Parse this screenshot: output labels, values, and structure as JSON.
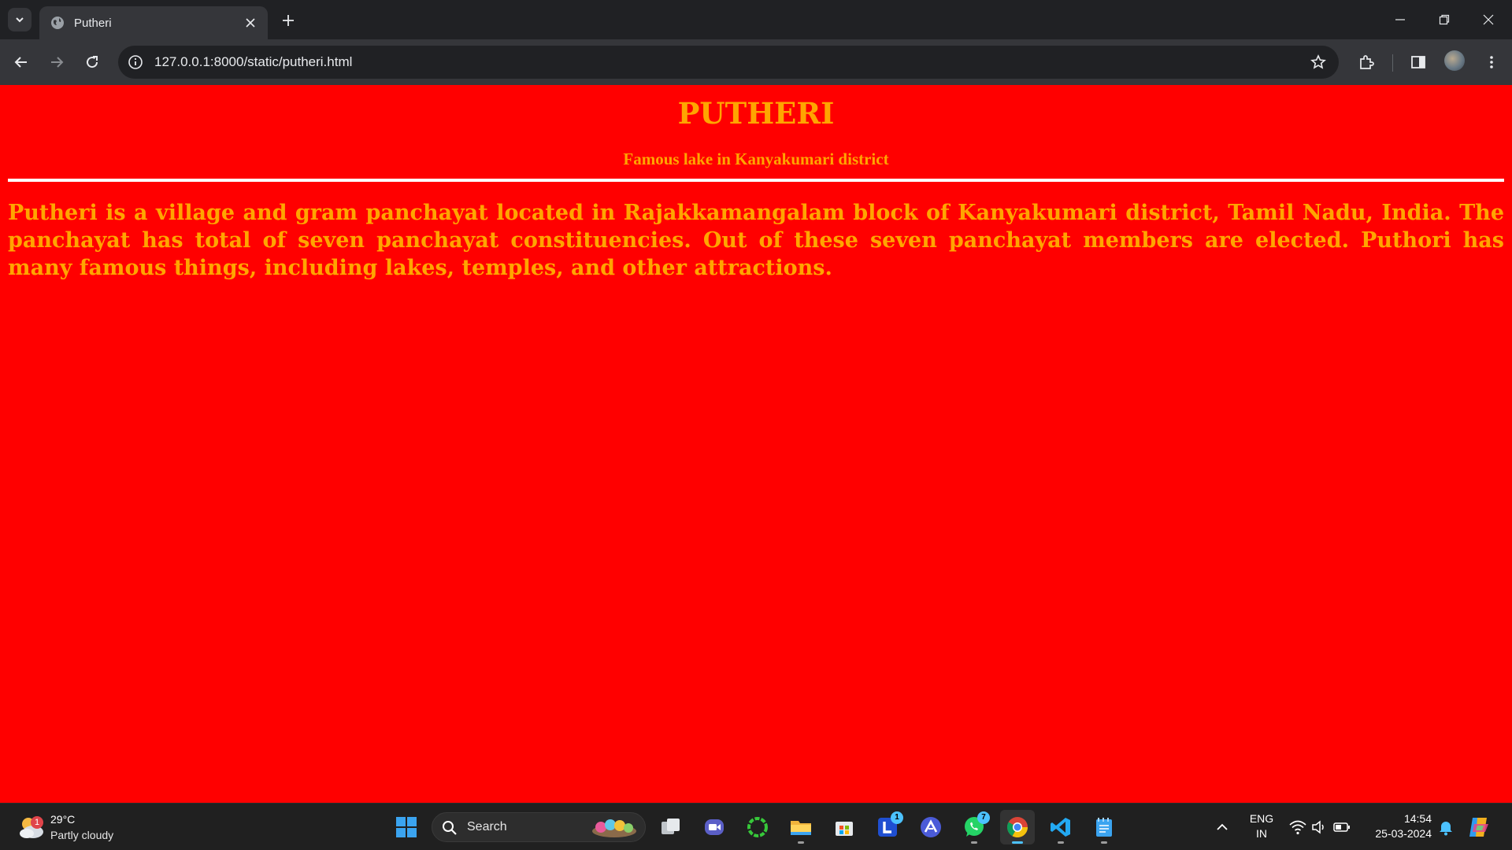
{
  "browser": {
    "tab": {
      "title": "Putheri"
    },
    "address_bar": {
      "url": "127.0.0.1:8000/static/putheri.html"
    }
  },
  "page": {
    "title": "PUTHERI",
    "subtitle": "Famous lake in Kanyakumari district",
    "body": "Putheri is a village and gram panchayat located in Rajakkamangalam block of Kanyakumari district, Tamil Nadu, India. The panchayat has total of seven panchayat constituencies. Out of these seven panchayat members are elected. Puthori has many famous things, including lakes, temples, and other attractions.",
    "colors": {
      "background": "#ff0000",
      "text": "#ffa500",
      "rule": "#ffffff"
    }
  },
  "taskbar": {
    "weather": {
      "temperature": "29°C",
      "condition": "Partly cloudy",
      "badge": "1"
    },
    "search_label": "Search",
    "apps": [
      {
        "name": "Start",
        "icon": "windows-start-icon"
      },
      {
        "name": "Task View",
        "icon": "task-view-icon"
      },
      {
        "name": "Meet",
        "icon": "video-meet-icon"
      },
      {
        "name": "App",
        "icon": "green-ring-icon"
      },
      {
        "name": "File Explorer",
        "icon": "folder-icon"
      },
      {
        "name": "Microsoft Store",
        "icon": "store-icon"
      },
      {
        "name": "L",
        "icon": "l-app-icon",
        "badge": "1"
      },
      {
        "name": "App",
        "icon": "triangle-app-icon"
      },
      {
        "name": "WhatsApp",
        "icon": "whatsapp-icon",
        "badge": "7"
      },
      {
        "name": "Chrome",
        "icon": "chrome-icon"
      },
      {
        "name": "VS Code",
        "icon": "vscode-icon"
      },
      {
        "name": "Notepad",
        "icon": "notepad-icon"
      }
    ],
    "tray": {
      "language_line1": "ENG",
      "language_line2": "IN",
      "time": "14:54",
      "date": "25-03-2024"
    }
  }
}
